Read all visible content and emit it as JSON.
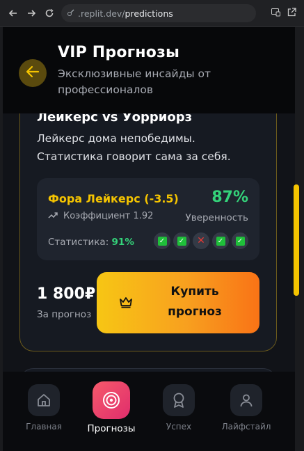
{
  "browser": {
    "url_prefix": ".replit.dev/",
    "url_path": "predictions"
  },
  "header": {
    "title": "VIP Прогнозы",
    "subtitle": "Эксклюзивные инсайды от профессионалов"
  },
  "card": {
    "title": "Лейкерс vs Уорриорз",
    "description": "Лейкерс дома непобедимы. Статистика говорит сама за себя.",
    "bet_label": "Фора Лейкерс (-3.5)",
    "coefficient_label": "Коэффициент 1.92",
    "confidence_value": "87%",
    "confidence_label": "Уверенность",
    "stats_label": "Статистика: ",
    "stats_value": "91%",
    "recent_results": [
      "win",
      "win",
      "loss",
      "win",
      "win"
    ],
    "price": "1 800₽",
    "price_label": "За прогноз",
    "buy_line1": "Купить",
    "buy_line2": "прогноз"
  },
  "bottom_nav": [
    {
      "label": "Главная",
      "icon": "home-icon",
      "active": false
    },
    {
      "label": "Прогнозы",
      "icon": "target-icon",
      "active": true
    },
    {
      "label": "Успех",
      "icon": "award-icon",
      "active": false
    },
    {
      "label": "Лайфстайл",
      "icon": "user-icon",
      "active": false
    }
  ],
  "colors": {
    "accent": "#f5c400",
    "positive": "#34d37a",
    "active_tab": "#ef4468"
  }
}
